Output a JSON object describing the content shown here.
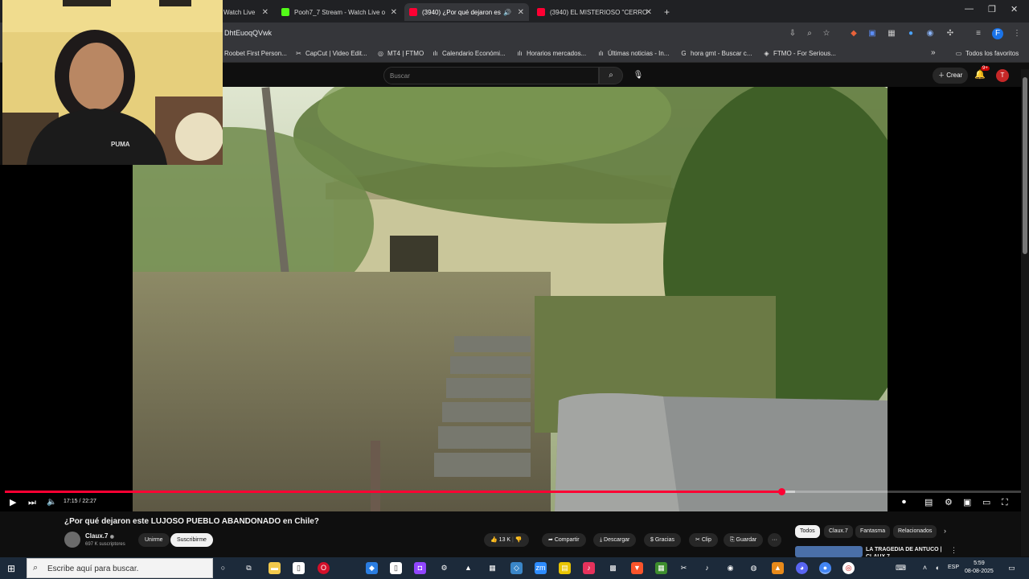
{
  "browser": {
    "tabs": [
      {
        "label": "Watch Live",
        "favicon_color": "#53fc18",
        "active": false
      },
      {
        "label": "Pooh7_7 Stream - Watch Live o",
        "favicon_color": "#53fc18",
        "active": false
      },
      {
        "label": "(3940) ¿Por qué dejaron es",
        "favicon_color": "#ff0033",
        "active": true
      },
      {
        "label": "(3940) EL MISTERIOSO \"CERRO",
        "favicon_color": "#ff0033",
        "active": false
      }
    ],
    "new_tab": "+",
    "url": "DhtEuoqQVwk",
    "bookmarks": [
      {
        "label": "Roobet First Person..."
      },
      {
        "label": "CapCut | Video Edit..."
      },
      {
        "label": "MT4 | FTMO"
      },
      {
        "label": "Calendario Económi..."
      },
      {
        "label": "Horarios mercados..."
      },
      {
        "label": "Últimas noticias - In..."
      },
      {
        "label": "hora gmt - Buscar c..."
      },
      {
        "label": "FTMO - For Serious..."
      }
    ],
    "all_favorites": "Todos los favoritos",
    "more": "»"
  },
  "youtube": {
    "search_placeholder": "Buscar",
    "create_label": "Crear",
    "notif_badge": "9+",
    "avatar_letter": "T",
    "player": {
      "time": "17:15 / 22:27",
      "progress": 0.764,
      "buffered": 0.778
    },
    "video_title": "¿Por qué dejaron este LUJOSO PUEBLO ABANDONADO en Chile?",
    "channel": {
      "name": "Claux.7",
      "subs": "697 K suscriptores",
      "join_label": "Unirme",
      "subscribe_label": "Suscribirme"
    },
    "actions": {
      "likes": "13 K",
      "share": "Compartir",
      "download": "Descargar",
      "thanks": "Gracias",
      "clip": "Clip",
      "save": "Guardar",
      "more": "···"
    },
    "chips": [
      "Todos",
      "Claux.7",
      "Fantasma",
      "Relacionados"
    ],
    "recommendation": {
      "title": "LA TRAGEDIA DE ANTUCO | CLAUX.7"
    }
  },
  "taskbar": {
    "search_text": "Escribe aquí para buscar.",
    "lang": "ESP",
    "time": "5:59",
    "date": "08-08-2025"
  },
  "colors": {
    "accent_red": "#ff0033",
    "taskbar": "#1c2a3a"
  }
}
